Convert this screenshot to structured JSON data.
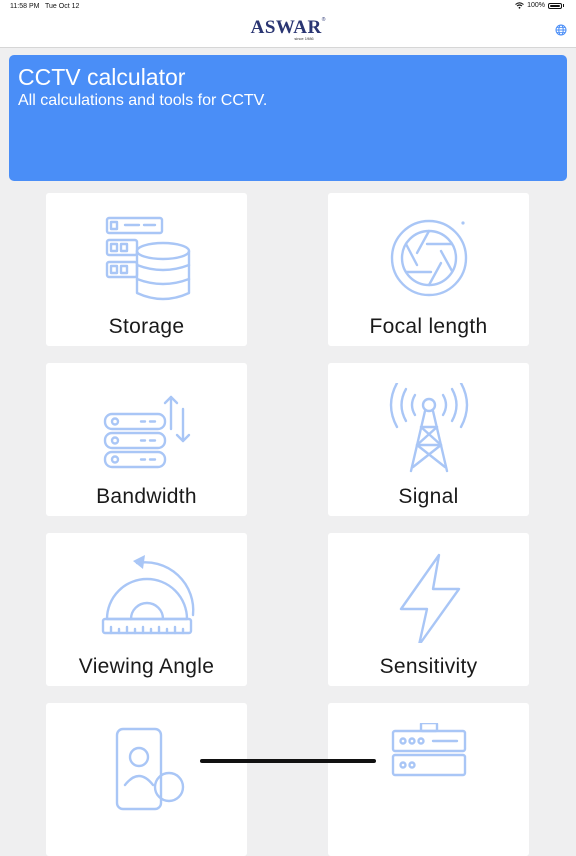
{
  "status_bar": {
    "time": "11:58 PM",
    "date": "Tue Oct 12",
    "battery": "100%"
  },
  "navbar": {
    "logo_text": "ASWAR",
    "logo_since": "since 1986",
    "globe_icon": "globe-icon"
  },
  "banner": {
    "title": "CCTV calculator",
    "subtitle": "All calculations and tools for CCTV.",
    "color": "#4a8ef7"
  },
  "tools": [
    {
      "label": "Storage",
      "icon": "storage-server-icon"
    },
    {
      "label": "Focal length",
      "icon": "camera-aperture-icon"
    },
    {
      "label": "Bandwidth",
      "icon": "server-network-icon"
    },
    {
      "label": "Signal",
      "icon": "signal-tower-icon"
    },
    {
      "label": "Viewing Angle",
      "icon": "protractor-icon"
    },
    {
      "label": "Sensitivity",
      "icon": "lightning-icon"
    },
    {
      "label": "",
      "icon": "user-id-icon"
    },
    {
      "label": "",
      "icon": "dvr-device-icon"
    }
  ],
  "colors": {
    "icon_stroke": "#a9c6f6",
    "background": "#efeff0"
  }
}
